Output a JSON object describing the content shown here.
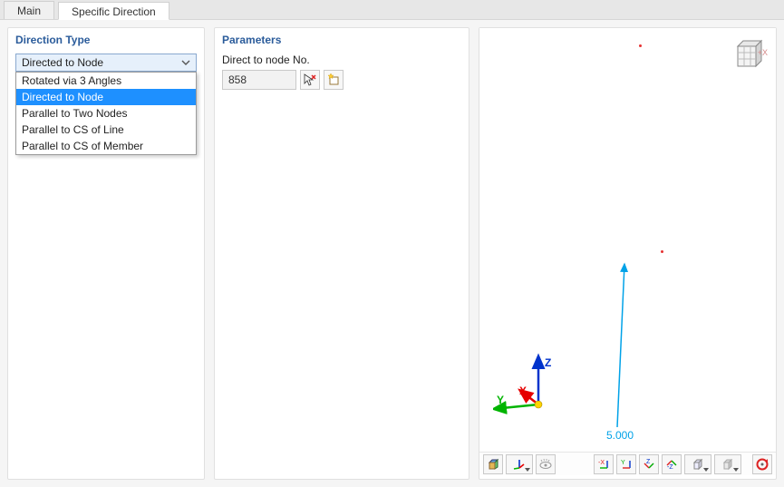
{
  "tabs": {
    "main": "Main",
    "specific_direction": "Specific Direction"
  },
  "left": {
    "title": "Direction Type",
    "combo_value": "Directed to Node",
    "options": {
      "rotated": "Rotated via 3 Angles",
      "directed": "Directed to Node",
      "parallel_two_nodes": "Parallel to Two Nodes",
      "parallel_cs_line": "Parallel to CS of Line",
      "parallel_cs_member": "Parallel to CS of Member"
    }
  },
  "middle": {
    "title": "Parameters",
    "label": "Direct to node No.",
    "node_value": "858"
  },
  "viewport": {
    "dim_label": "5.000",
    "axis_x": "X",
    "axis_y": "Y",
    "axis_z": "Z",
    "cube_x": "+X"
  }
}
